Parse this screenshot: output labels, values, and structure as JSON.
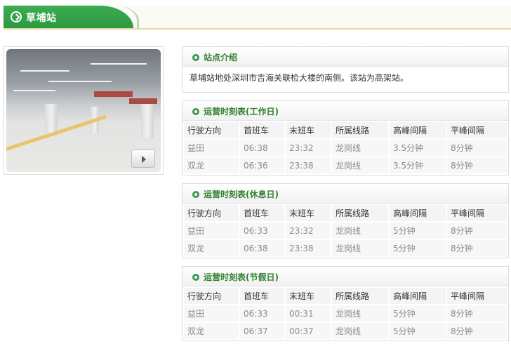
{
  "station": {
    "name": "草埔站"
  },
  "intro": {
    "title": "站点介绍",
    "text": "草埔站地处深圳市吉海关联检大楼的南侧。该站为高架站。"
  },
  "columns": [
    "行驶方向",
    "首班车",
    "末班车",
    "所属线路",
    "高峰间隔",
    "平峰间隔"
  ],
  "schedules": [
    {
      "title": "运营时刻表(工作日)",
      "rows": [
        [
          "益田",
          "06:38",
          "23:32",
          "龙岗线",
          "3.5分钟",
          "8分钟"
        ],
        [
          "双龙",
          "06:36",
          "23:38",
          "龙岗线",
          "3.5分钟",
          "8分钟"
        ]
      ]
    },
    {
      "title": "运营时刻表(休息日)",
      "rows": [
        [
          "益田",
          "06:33",
          "23:32",
          "龙岗线",
          "5分钟",
          "8分钟"
        ],
        [
          "双龙",
          "06:38",
          "23:38",
          "龙岗线",
          "5分钟",
          "8分钟"
        ]
      ]
    },
    {
      "title": "运营时刻表(节假日)",
      "rows": [
        [
          "益田",
          "06:33",
          "00:31",
          "龙岗线",
          "5分钟",
          "8分钟"
        ],
        [
          "双龙",
          "06:37",
          "00:37",
          "龙岗线",
          "5分钟",
          "8分钟"
        ]
      ]
    }
  ],
  "icons": {
    "header": "circle-chevron-right-icon",
    "panel": "green-ring-bullet-icon",
    "photo_next": "play-arrow-icon"
  },
  "colors": {
    "accent_green": "#2c9a40",
    "title_green": "#2f7f2f",
    "header_rule": "#e9d49a"
  }
}
